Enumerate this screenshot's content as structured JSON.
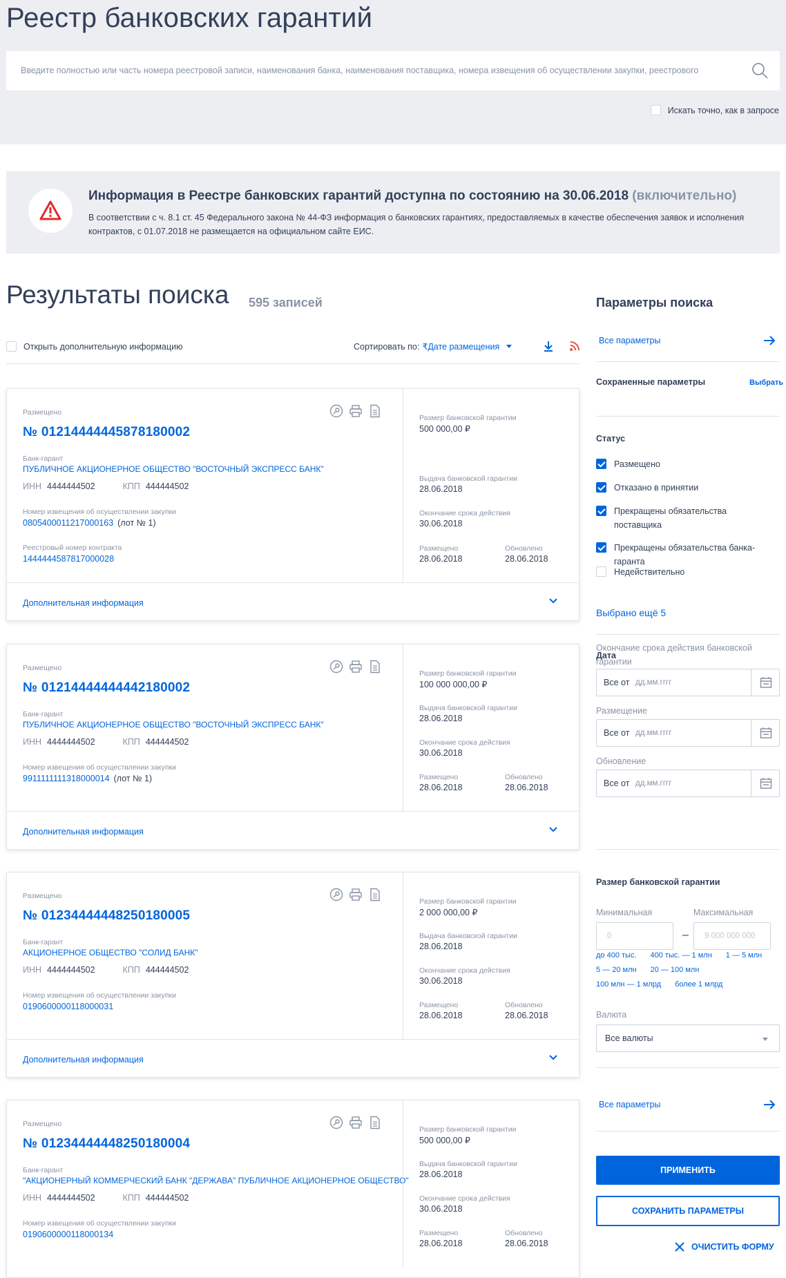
{
  "page_title": "Реестр банковских гарантий",
  "search": {
    "placeholder": "Введите полностью или часть номера реестровой записи, наименования банка, наименования поставщика, номера извещения об осуществлении закупки, реестрового",
    "exact_label": "Искать точно, как в запросе"
  },
  "notice": {
    "title": "Информация в Реестре банковских гарантий доступна по состоянию на 30.06.2018",
    "title_muted": "(включительно)",
    "text": "В соответствии с ч. 8.1 ст. 45 Федерального закона № 44-ФЗ информация о банковских гарантиях, предоставляемых в качестве обеспечения заявок и исполнения контрактов, с 01.07.2018 не размещается на официальном сайте ЕИС."
  },
  "results": {
    "title": "Результаты поиска",
    "count": "595 записей",
    "open_additional": "Открыть дополнительную информацию",
    "sort_label": "Сортировать по:",
    "sort_value": "Дате размещения"
  },
  "labels": {
    "bank": "Банк-гарант",
    "inn": "ИНН",
    "kpp": "КПП",
    "notice_num": "Номер извещения об осуществлении закупки",
    "contract_num": "Реестровый номер контракта",
    "amount": "Размер банковской гарантии",
    "issue": "Выдача банковской гарантии",
    "end": "Окончание срока действия",
    "placed": "Размещено",
    "updated": "Обновлено",
    "additional": "Дополнительная информация"
  },
  "cards": [
    {
      "status": "Размещено",
      "number": "№ 01214444445878180002",
      "bank": "ПУБЛИЧНОЕ АКЦИОНЕРНОЕ ОБЩЕСТВО \"ВОСТОЧНЫЙ ЭКСПРЕСС БАНК\"",
      "inn": "4444444502",
      "kpp": "444444502",
      "notice_num": "0805400011217000163",
      "lot": "(лот № 1)",
      "contract_num": "1444444587817000028",
      "amount": "500 000,00 ₽",
      "issue": "28.06.2018",
      "end": "30.06.2018",
      "placed": "28.06.2018",
      "updated": "28.06.2018"
    },
    {
      "status": "Размещено",
      "number": "№ 01214444444442180002",
      "bank": "ПУБЛИЧНОЕ АКЦИОНЕРНОЕ ОБЩЕСТВО \"ВОСТОЧНЫЙ ЭКСПРЕСС БАНК\"",
      "inn": "4444444502",
      "kpp": "444444502",
      "notice_num": "9911111111318000014",
      "lot": "(лот № 1)",
      "amount": "100 000 000,00 ₽",
      "issue": "28.06.2018",
      "end": "30.06.2018",
      "placed": "28.06.2018",
      "updated": "28.06.2018"
    },
    {
      "status": "Размещено",
      "number": "№ 01234444448250180005",
      "bank": "АКЦИОНЕРНОЕ ОБЩЕСТВО \"СОЛИД БАНК\"",
      "inn": "4444444502",
      "kpp": "444444502",
      "notice_num": "0190600000118000031",
      "amount": "2 000 000,00 ₽",
      "issue": "28.06.2018",
      "end": "30.06.2018",
      "placed": "28.06.2018",
      "updated": "28.06.2018"
    },
    {
      "status": "Размещено",
      "number": "№ 01234444448250180004",
      "bank": "\"АКЦИОНЕРНЫЙ КОММЕРЧЕСКИЙ БАНК \"ДЕРЖАВА\" ПУБЛИЧНОЕ АКЦИОНЕРНОЕ ОБЩЕСТВО\"",
      "inn": "4444444502",
      "kpp": "444444502",
      "notice_num": "0190600000118000134",
      "amount": "500 000,00 ₽",
      "issue": "28.06.2018",
      "end": "30.06.2018",
      "placed": "28.06.2018",
      "updated": "28.06.2018"
    }
  ],
  "side": {
    "title": "Параметры поиска",
    "all_params": "Все параметры",
    "saved": "Сохраненные параметры",
    "choose": "Выбрать",
    "status_title": "Статус",
    "statuses": [
      {
        "label": "Размещено",
        "checked": true
      },
      {
        "label": "Отказано в принятии",
        "checked": true
      },
      {
        "label": "Прекращены обязательства поставщика",
        "checked": true
      },
      {
        "label": "Прекращены обязательства банка-гаранта",
        "checked": true
      },
      {
        "label": "Недействительно",
        "checked": false
      }
    ],
    "more": "Выбрано ещё 5",
    "date_title": "Дата",
    "date_fields": [
      {
        "label": "Окончание срока действия банковской гарантии",
        "prefix": "Все от",
        "placeholder": "дд.мм.гггг"
      },
      {
        "label": "Размещение",
        "prefix": "Все от",
        "placeholder": "дд.мм.гггг"
      },
      {
        "label": "Обновление",
        "prefix": "Все от",
        "placeholder": "дд.мм.гггг"
      }
    ],
    "size_title": "Размер банковской гарантии",
    "min_label": "Минимальная",
    "max_label": "Максимальная",
    "min_ph": "0",
    "max_ph": "9 000 000 000",
    "chips_row1": [
      "до 400 тыс.",
      "400 тыс. — 1 млн",
      "1 — 5 млн"
    ],
    "chips_row2": [
      "5 — 20 млн",
      "20 — 100 млн"
    ],
    "chips_row3": [
      "100 млн — 1 млрд",
      "более 1 млрд"
    ],
    "currency_label": "Валюта",
    "currency_value": "Все валюты",
    "apply": "ПРИМЕНИТЬ",
    "save": "СОХРАНИТЬ ПАРАМЕТРЫ",
    "clear": "ОЧИСТИТЬ ФОРМУ"
  },
  "colors": {
    "accent": "#0065dd",
    "text": "#334059",
    "muted": "#8a94a6",
    "bg": "#eceef2",
    "warn": "#e02b2b"
  }
}
